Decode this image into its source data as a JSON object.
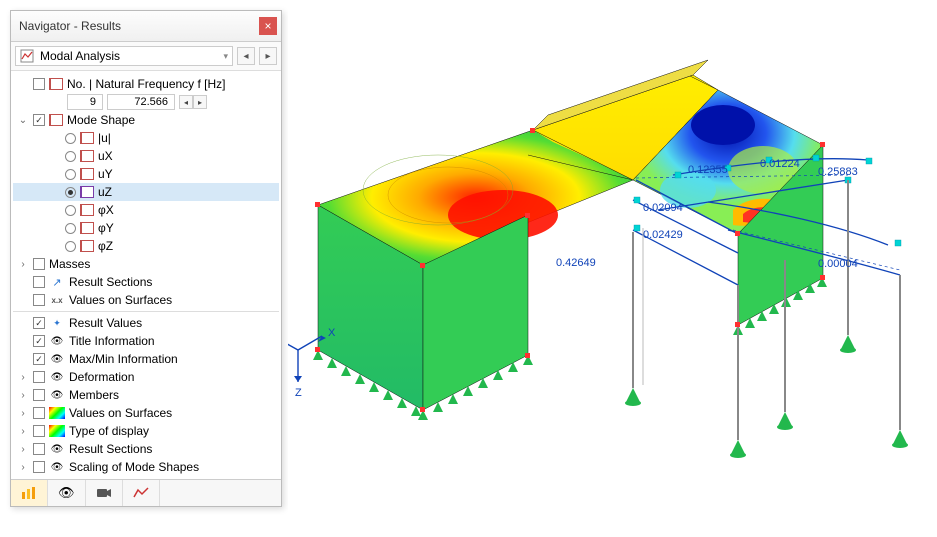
{
  "panel": {
    "title": "Navigator - Results",
    "analysis_label": "Modal Analysis",
    "freq_header": "No. | Natural Frequency f [Hz]",
    "freq_no": "9",
    "freq_val": "72.566",
    "mode_shape": "Mode Shape",
    "components": {
      "u": "|u|",
      "ux": "uₓ",
      "uy": "uᵧ",
      "uz": "uᵤ",
      "uz_label": "uZ",
      "phix": "φₓ",
      "phiy": "φᵧ",
      "phiz": "φᵤ",
      "ux_label": "uX",
      "uy_label": "uY",
      "phix_label": "φX",
      "phiy_label": "φY",
      "phiz_label": "φZ"
    },
    "masses": "Masses",
    "result_sections": "Result Sections",
    "values_on_surfaces": "Values on Surfaces",
    "result_values": "Result Values",
    "title_info": "Title Information",
    "maxmin_info": "Max/Min Information",
    "deformation": "Deformation",
    "members": "Members",
    "values_on_surfaces2": "Values on Surfaces",
    "type_of_display": "Type of display",
    "result_sections2": "Result Sections",
    "scaling": "Scaling of Mode Shapes"
  },
  "viewport": {
    "values": {
      "v1": "0.12355",
      "v2": "0.01224",
      "v3": "0.25883",
      "v4": "0.02094",
      "v5": "0.02429",
      "v6": "0.00004",
      "v7": "0.42649"
    },
    "axes": {
      "x": "X",
      "z": "Z"
    }
  }
}
